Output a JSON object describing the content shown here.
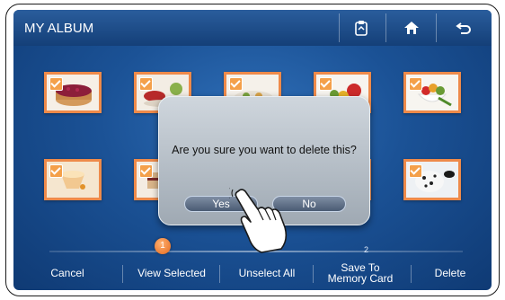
{
  "header": {
    "title": "MY ALBUM",
    "icons": [
      "memo-icon",
      "home-icon",
      "back-icon"
    ]
  },
  "album": {
    "thumbnails": [
      {
        "subject": "berry tart",
        "selected": true
      },
      {
        "subject": "cake with fruit",
        "selected": true
      },
      {
        "subject": "dessert plate",
        "selected": true
      },
      {
        "subject": "fruit platter",
        "selected": true
      },
      {
        "subject": "fruit bowl",
        "selected": true
      },
      {
        "subject": "mousse cup",
        "selected": true
      },
      {
        "subject": "cake slice",
        "selected": true
      },
      {
        "subject": "plated dessert",
        "selected": true
      },
      {
        "subject": "strawberries",
        "selected": true
      },
      {
        "subject": "cookies and cream ice cream",
        "selected": true
      }
    ]
  },
  "dialog": {
    "message": "Are you sure you want to delete this?",
    "yes_label": "Yes",
    "no_label": "No"
  },
  "pager": {
    "current_page": "1",
    "next_page": "2"
  },
  "bottombar": {
    "cancel": "Cancel",
    "view_selected": "View Selected",
    "unselect_all": "Unselect All",
    "save_line1": "Save To",
    "save_line2": "Memory Card",
    "delete": "Delete"
  },
  "colors": {
    "accent": "#ee8a4a",
    "screen_blue": "#1b5296"
  }
}
